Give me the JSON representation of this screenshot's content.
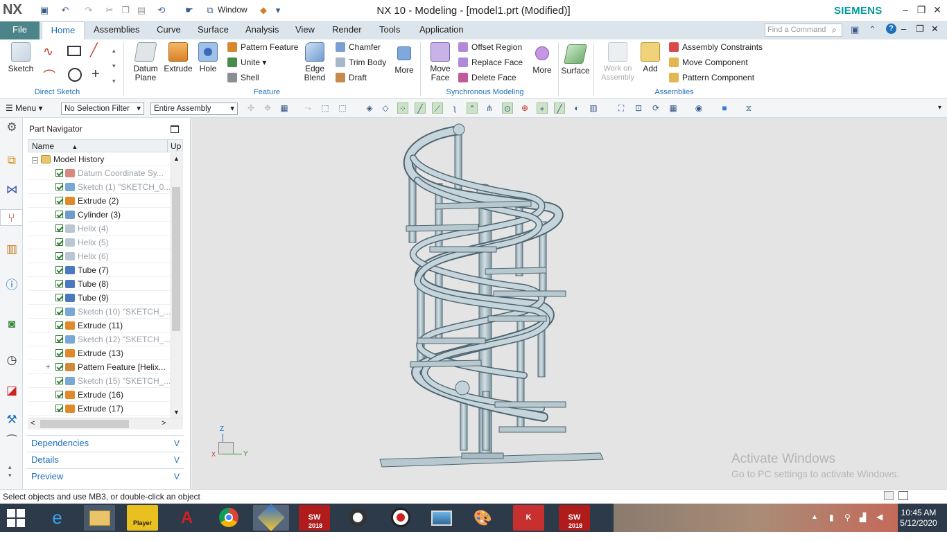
{
  "app": {
    "logo": "NX",
    "title": "NX 10 - Modeling - [model1.prt (Modified)]",
    "brand": "SIEMENS",
    "window_menu": "Window"
  },
  "ribbon_tabs": [
    "File",
    "Home",
    "Assemblies",
    "Curve",
    "Surface",
    "Analysis",
    "View",
    "Render",
    "Tools",
    "Application"
  ],
  "find_command_placeholder": "Find a Command",
  "ribbon": {
    "direct_sketch": {
      "label": "Direct Sketch",
      "sketch": "Sketch"
    },
    "feature": {
      "label": "Feature",
      "datum_plane": "Datum Plane",
      "extrude": "Extrude",
      "hole": "Hole",
      "pattern_feature": "Pattern Feature",
      "unite": "Unite",
      "shell": "Shell",
      "edge_blend": "Edge Blend",
      "chamfer": "Chamfer",
      "trim_body": "Trim Body",
      "draft": "Draft",
      "more": "More"
    },
    "synchronous": {
      "label": "Synchronous Modeling",
      "move_face": "Move Face",
      "offset_region": "Offset Region",
      "replace_face": "Replace Face",
      "delete_face": "Delete Face",
      "more": "More"
    },
    "surface": {
      "label": "Surface"
    },
    "assemblies": {
      "label": "Assemblies",
      "work_on_assembly": "Work on Assembly",
      "add": "Add",
      "assembly_constraints": "Assembly Constraints",
      "move_component": "Move Component",
      "pattern_component": "Pattern Component"
    }
  },
  "selection_bar": {
    "menu": "Menu",
    "selection_filter": "No Selection Filter",
    "scope": "Entire Assembly"
  },
  "navigator": {
    "title": "Part Navigator",
    "columns": [
      "Name",
      "Up"
    ],
    "root": "Model History",
    "items": [
      {
        "label": "Datum Coordinate Sy...",
        "dim": true,
        "icon": "datum-csys-icon"
      },
      {
        "label": "Sketch (1) \"SKETCH_0...",
        "dim": true,
        "icon": "sketch-icon"
      },
      {
        "label": "Extrude (2)",
        "dim": false,
        "icon": "extrude-icon"
      },
      {
        "label": "Cylinder (3)",
        "dim": false,
        "icon": "cylinder-icon"
      },
      {
        "label": "Helix (4)",
        "dim": true,
        "icon": "helix-icon"
      },
      {
        "label": "Helix (5)",
        "dim": true,
        "icon": "helix-icon"
      },
      {
        "label": "Helix (6)",
        "dim": true,
        "icon": "helix-icon"
      },
      {
        "label": "Tube (7)",
        "dim": false,
        "icon": "tube-icon"
      },
      {
        "label": "Tube (8)",
        "dim": false,
        "icon": "tube-icon"
      },
      {
        "label": "Tube (9)",
        "dim": false,
        "icon": "tube-icon"
      },
      {
        "label": "Sketch (10) \"SKETCH_...",
        "dim": true,
        "icon": "sketch-icon"
      },
      {
        "label": "Extrude (11)",
        "dim": false,
        "icon": "extrude-icon"
      },
      {
        "label": "Sketch (12) \"SKETCH_...",
        "dim": true,
        "icon": "sketch-icon"
      },
      {
        "label": "Extrude (13)",
        "dim": false,
        "icon": "extrude-icon"
      },
      {
        "label": "Pattern Feature [Helix...",
        "dim": false,
        "icon": "pattern-icon"
      },
      {
        "label": "Sketch (15) \"SKETCH_...",
        "dim": true,
        "icon": "sketch-icon"
      },
      {
        "label": "Extrude (16)",
        "dim": false,
        "icon": "extrude-icon"
      },
      {
        "label": "Extrude (17)",
        "dim": false,
        "icon": "extrude-icon"
      }
    ],
    "panels": [
      "Dependencies",
      "Details",
      "Preview"
    ]
  },
  "triad": {
    "z": "Z",
    "y": "Y",
    "x": "X"
  },
  "watermark": {
    "line1": "Activate Windows",
    "line2": "Go to PC settings to activate Windows."
  },
  "status": "Select objects and use MB3, or double-click an object",
  "taskbar": {
    "time": "10:45 AM",
    "date": "5/12/2020",
    "sw1": "2018",
    "sw2": "2018",
    "player": "Player"
  },
  "colors": {
    "accent": "#1e6fb8",
    "file_tab": "#4c8589",
    "brand": "#009999",
    "model": "#b7c8cf"
  }
}
